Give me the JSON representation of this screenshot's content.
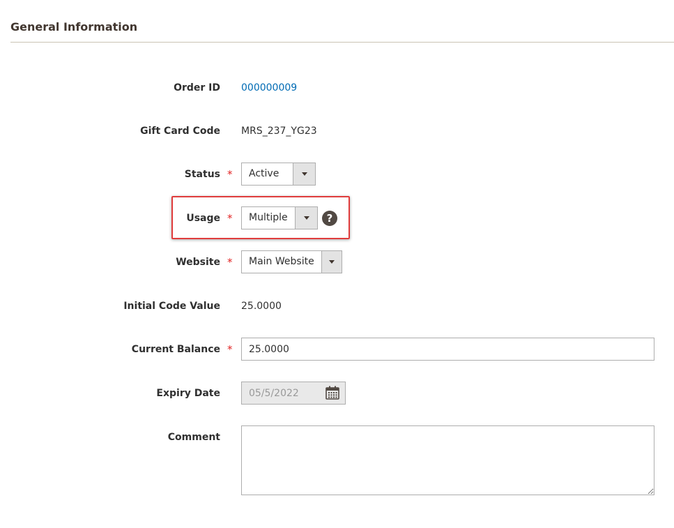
{
  "section": {
    "title": "General Information"
  },
  "fields": {
    "order_id": {
      "label": "Order ID",
      "value": "000000009"
    },
    "gift_card_code": {
      "label": "Gift Card Code",
      "value": "MRS_237_YG23"
    },
    "status": {
      "label": "Status",
      "required_mark": "*",
      "selected": "Active"
    },
    "usage": {
      "label": "Usage",
      "required_mark": "*",
      "selected": "Multiple",
      "help_glyph": "?"
    },
    "website": {
      "label": "Website",
      "required_mark": "*",
      "selected": "Main Website"
    },
    "initial_code_value": {
      "label": "Initial Code Value",
      "value": "25.0000"
    },
    "current_balance": {
      "label": "Current Balance",
      "required_mark": "*",
      "value": "25.0000"
    },
    "expiry_date": {
      "label": "Expiry Date",
      "value": "05/5/2022"
    },
    "comment": {
      "label": "Comment",
      "value": ""
    }
  },
  "colors": {
    "link": "#006bb4",
    "required": "#e22626",
    "highlight": "#e03c3c",
    "help_icon": "#514943"
  },
  "icons": {
    "help": "question-circle-icon",
    "calendar": "calendar-icon",
    "dropdown": "chevron-down-icon"
  }
}
